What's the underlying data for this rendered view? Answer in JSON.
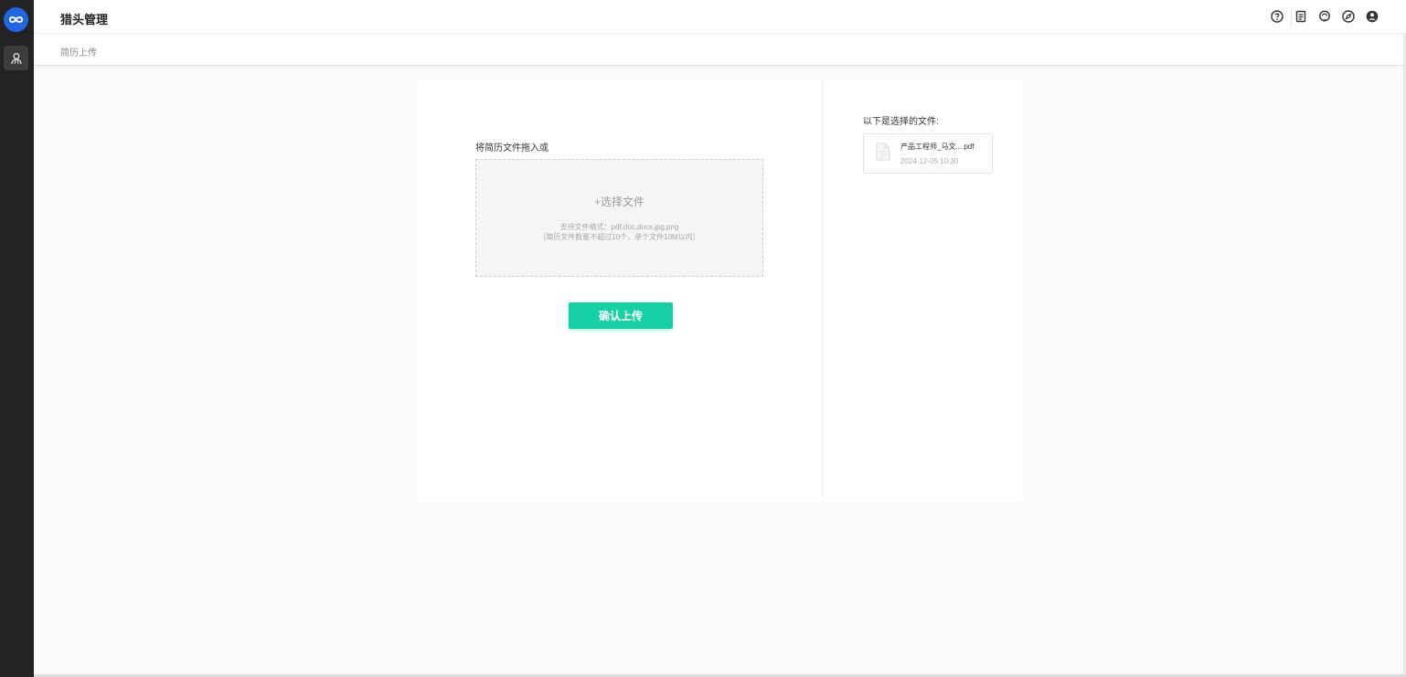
{
  "header": {
    "app_title": "猎头管理",
    "icons": [
      "help-icon",
      "document-icon",
      "support-icon",
      "compass-icon",
      "user-icon"
    ]
  },
  "breadcrumb": "简历上传",
  "upload": {
    "drop_label": "将简历文件拖入或",
    "choose_text": "+选择文件",
    "hint_formats": "支持文件格式：pdf,doc,docx,jpg,png",
    "hint_limits": "（简历文件数量不超过10个，单个文件10M以内）",
    "confirm_label": "确认上传"
  },
  "selected": {
    "title": "以下是选择的文件:",
    "files": [
      {
        "name": "产品工程师_马文....pdf",
        "time": "2024-12-05 10:30"
      }
    ]
  },
  "colors": {
    "accent": "#16d1a5",
    "sidebar": "#232323",
    "logo": "#1f66e0"
  }
}
